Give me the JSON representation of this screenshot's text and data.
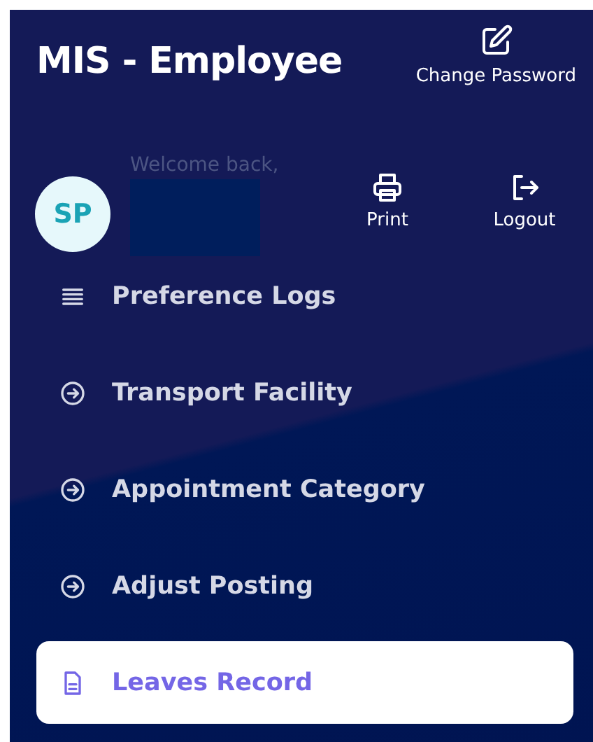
{
  "header": {
    "title": "MIS - Employee",
    "change_password": "Change Password"
  },
  "profile": {
    "initials": "SP",
    "welcome": "Welcome back,",
    "name_redacted": true
  },
  "actions": [
    {
      "kind": "print",
      "label": "Print"
    },
    {
      "kind": "logout",
      "label": "Logout"
    }
  ],
  "menu": [
    {
      "kind": "list",
      "label": "Preference Logs",
      "selected": false
    },
    {
      "kind": "arrow",
      "label": "Transport Facility",
      "selected": false
    },
    {
      "kind": "arrow",
      "label": "Appointment Category",
      "selected": false
    },
    {
      "kind": "arrow",
      "label": "Adjust Posting",
      "selected": false
    },
    {
      "kind": "doc",
      "label": "Leaves Record",
      "selected": true
    }
  ]
}
